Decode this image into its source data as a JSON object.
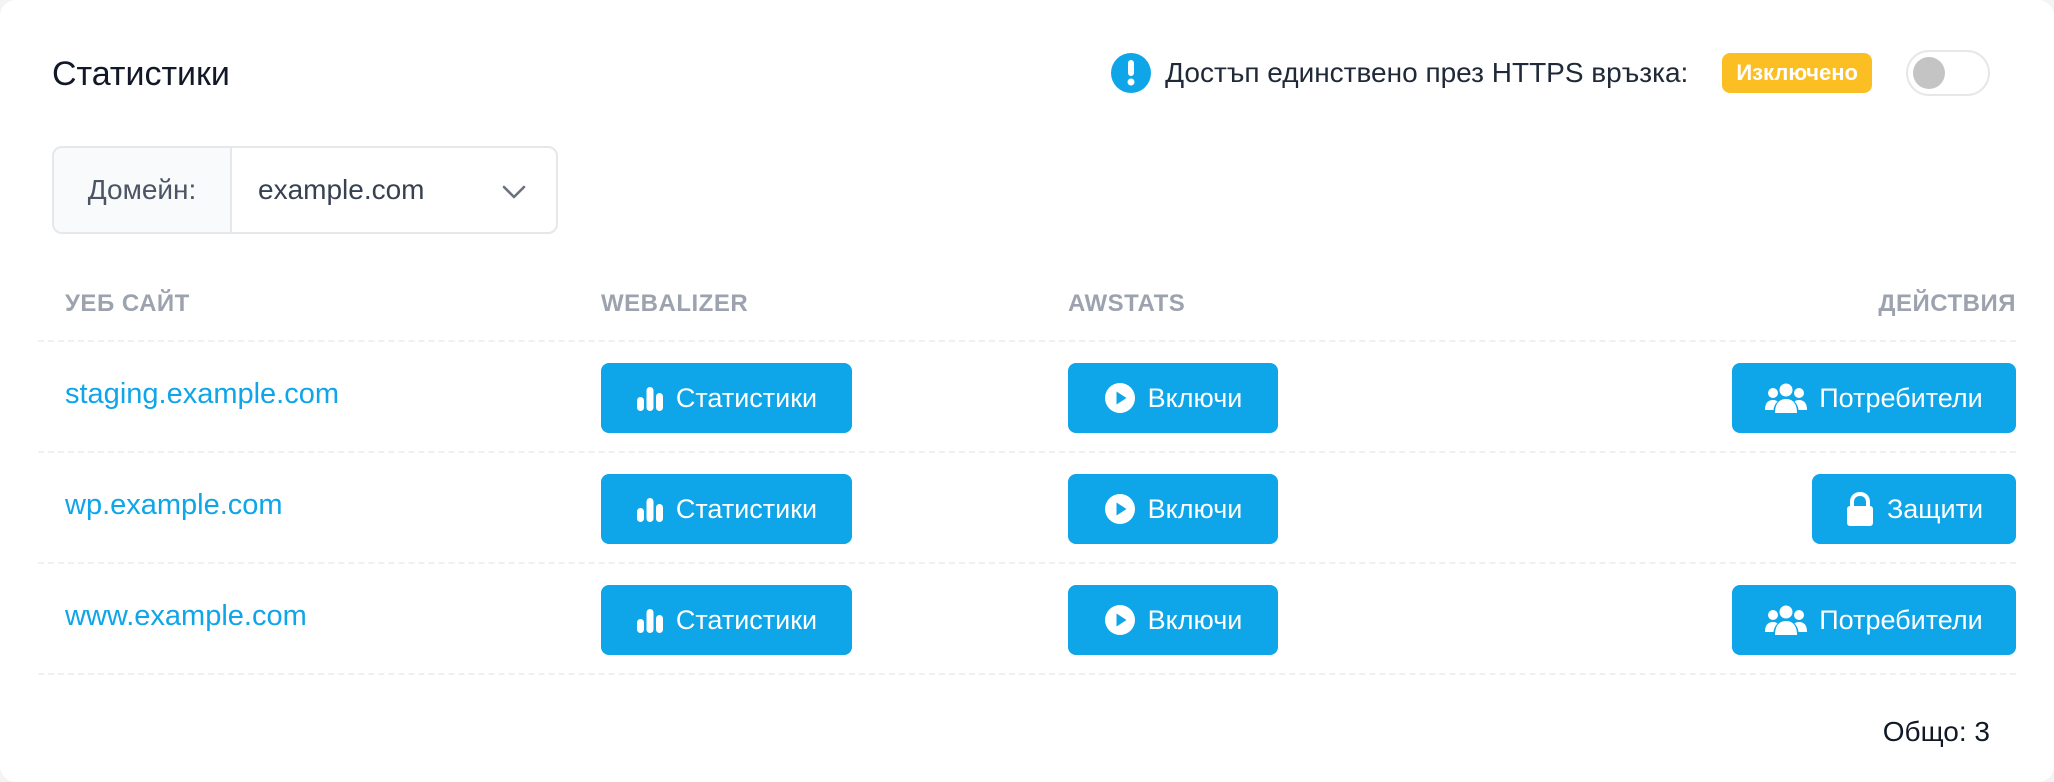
{
  "page": {
    "title": "Статистики"
  },
  "https": {
    "label": "Достъп единствено през HTTPS връзка:",
    "status": "Изключено",
    "enabled": false
  },
  "domain": {
    "label": "Домейн:",
    "selected": "example.com"
  },
  "table": {
    "headers": {
      "site": "УЕБ САЙТ",
      "webalizer": "WEBALIZER",
      "awstats": "AWSTATS",
      "actions": "ДЕЙСТВИЯ"
    },
    "rows": [
      {
        "site": "staging.example.com",
        "webalizer": "Статистики",
        "awstats": "Включи",
        "action": "Потребители",
        "action_icon": "users-icon"
      },
      {
        "site": "wp.example.com",
        "webalizer": "Статистики",
        "awstats": "Включи",
        "action": "Защити",
        "action_icon": "lock-icon"
      },
      {
        "site": "www.example.com",
        "webalizer": "Статистики",
        "awstats": "Включи",
        "action": "Потребители",
        "action_icon": "users-icon"
      }
    ]
  },
  "footer": {
    "total": "Общо: 3"
  },
  "colors": {
    "accent": "#0ea5e9",
    "badge": "#fbbf24"
  }
}
